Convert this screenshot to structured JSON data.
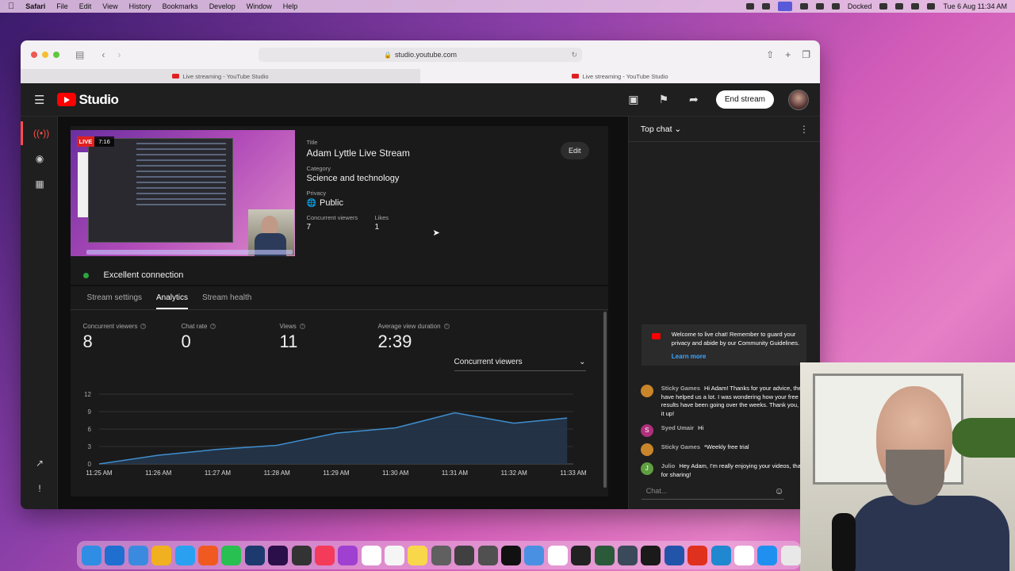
{
  "menubar": {
    "app": "Safari",
    "items": [
      "File",
      "Edit",
      "View",
      "History",
      "Bookmarks",
      "Develop",
      "Window",
      "Help"
    ],
    "docked_label": "Docked",
    "datetime": "Tue 6 Aug  11:34 AM"
  },
  "browser": {
    "url": "studio.youtube.com",
    "tabs": [
      "Live streaming - YouTube Studio",
      "Live streaming - YouTube Studio"
    ]
  },
  "header": {
    "logo_text": "Studio",
    "end_stream_label": "End stream"
  },
  "stream": {
    "live_label": "LIVE",
    "elapsed": "7:16",
    "title_label": "Title",
    "title": "Adam Lyttle Live Stream",
    "category_label": "Category",
    "category": "Science and technology",
    "privacy_label": "Privacy",
    "privacy": "Public",
    "concurrent_viewers_label": "Concurrent viewers",
    "concurrent_viewers": "7",
    "likes_label": "Likes",
    "likes": "1",
    "edit_label": "Edit",
    "connection_status": "Excellent connection",
    "connection_color": "#2ba640"
  },
  "analytics": {
    "tabs": [
      "Stream settings",
      "Analytics",
      "Stream health"
    ],
    "active_tab": "Analytics",
    "stats": [
      {
        "label": "Concurrent viewers",
        "value": "8"
      },
      {
        "label": "Chat rate",
        "value": "0"
      },
      {
        "label": "Views",
        "value": "11"
      },
      {
        "label": "Average view duration",
        "value": "2:39"
      }
    ],
    "metric_select": "Concurrent viewers"
  },
  "chart_data": {
    "type": "area",
    "title": "",
    "xlabel": "",
    "ylabel": "",
    "x": [
      "11:25 AM",
      "11:26 AM",
      "11:27 AM",
      "11:28 AM",
      "11:29 AM",
      "11:30 AM",
      "11:31 AM",
      "11:32 AM",
      "11:33 AM"
    ],
    "values": [
      0,
      1.5,
      2.5,
      3.2,
      5.3,
      6.2,
      8.8,
      7.0,
      7.9
    ],
    "yticks": [
      0,
      3,
      6,
      9,
      12
    ],
    "ylim": [
      0,
      12
    ],
    "grid": true,
    "line_color": "#3e8ed0",
    "fill_color": "#25364a"
  },
  "chat": {
    "mode": "Top chat",
    "welcome_text": "Welcome to live chat! Remember to guard your privacy and abide by our Community Guidelines.",
    "learn_more": "Learn more",
    "messages": [
      {
        "author": "Sticky Games",
        "text": "Hi Adam! Thanks for your advice, they have helped us a lot. I was wondering how your free trial results have been going over the weeks. Thank you, keep it up!",
        "avatar_color": "#c8852a",
        "initial": ""
      },
      {
        "author": "Syed Umair",
        "text": "Hi",
        "avatar_color": "#b0307c",
        "initial": "S"
      },
      {
        "author": "Sticky Games",
        "text": "*Weekly free trial",
        "avatar_color": "#c8852a",
        "initial": ""
      },
      {
        "author": "Julio",
        "text": "Hey Adam, I'm really enjoying your videos, thanks for sharing!",
        "avatar_color": "#5ea040",
        "initial": "J"
      }
    ],
    "input_placeholder": "Chat..."
  },
  "dock": {
    "icons": [
      "finder-icon",
      "vscode-icon",
      "xcode-icon",
      "chrome-icon",
      "safari-icon",
      "brave-icon",
      "whatsapp-icon",
      "photoshop-icon",
      "premiere-icon",
      "obs-icon",
      "music-icon",
      "podcasts-icon",
      "calendar-icon",
      "reminders-icon",
      "notes-icon",
      "screenshot-icon",
      "calculator-icon",
      "grid-icon",
      "x-icon",
      "app-icon",
      "textedit-icon",
      "git-icon",
      "flask-icon",
      "shield-icon",
      "gem-icon",
      "mp3-icon",
      "audio-icon",
      "browser-icon",
      "openai-icon",
      "appstore-icon",
      "preview-icon"
    ],
    "colors": [
      "#2f8de4",
      "#1f6fd0",
      "#3a8be0",
      "#f0b020",
      "#2aa0f0",
      "#f05a20",
      "#28c050",
      "#1d3a6e",
      "#2a0f4a",
      "#333333",
      "#f53b5a",
      "#a040d0",
      "#ffffff",
      "#f5f5f5",
      "#f8d84a",
      "#606060",
      "#404040",
      "#505050",
      "#111111",
      "#4a90e2",
      "#ffffff",
      "#222222",
      "#2a5a3a",
      "#3a4a5a",
      "#1a1a1a",
      "#2255aa",
      "#e0301e",
      "#2088d0",
      "#ffffff",
      "#2090f0",
      "#e8e8e8"
    ]
  }
}
